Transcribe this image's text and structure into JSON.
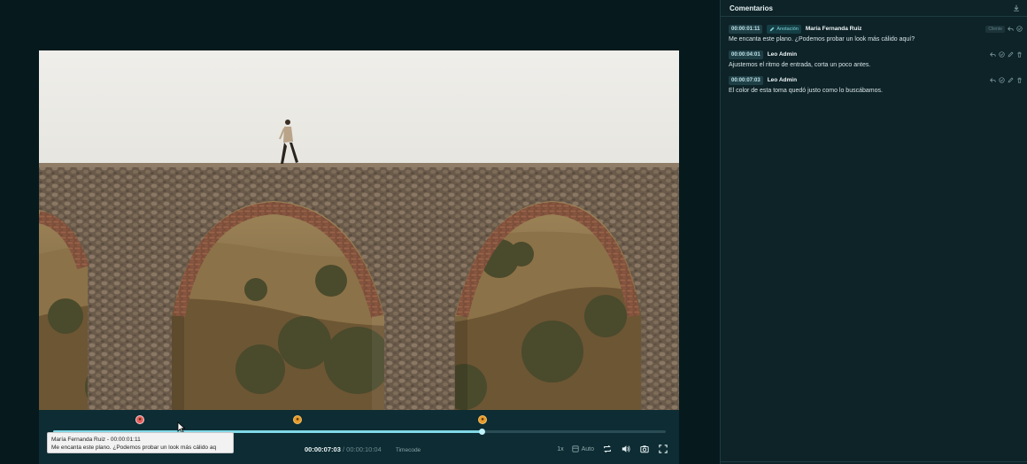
{
  "panel": {
    "title": "Comentarios",
    "download_icon": "download-icon"
  },
  "comments": [
    {
      "timecode": "00:00:01:11",
      "tag": "Anotación",
      "author": "María Fernanda Ruiz",
      "badge": "Cliente",
      "text": "Me encanta este plano. ¿Podemos probar un look más cálido aquí?"
    },
    {
      "timecode": "00:00:04:01",
      "author": "Leo Admin",
      "text": "Ajustemos el ritmo de entrada, corta un poco antes."
    },
    {
      "timecode": "00:00:07:03",
      "author": "Leo Admin",
      "text": "El color de esta toma quedó justo como lo buscábamos."
    }
  ],
  "player": {
    "current_time": "00:00:07:03",
    "separator": "/",
    "duration": "00:00:10:04",
    "time_mode": "Timecode",
    "speed": "1x",
    "quality": "Auto",
    "progress": 0.7,
    "markers": [
      {
        "position": 0.14,
        "active": true
      },
      {
        "position": 0.4,
        "active": false
      },
      {
        "position": 0.7,
        "active": false
      }
    ],
    "tooltip": {
      "line1": "María Fernanda Ruiz - 00:00:01:11",
      "line2": "Me encanta este plano. ¿Podemos probar un look más cálido aq"
    }
  },
  "colors": {
    "accent": "#7fd8e6",
    "marker": "#e59a2a",
    "background": "#061a1e",
    "panel": "#0d2328"
  }
}
